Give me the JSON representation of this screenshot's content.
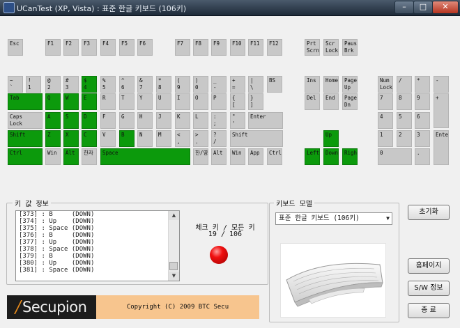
{
  "window": {
    "title": "UCanTest (XP, Vista) : 표준 한글 키보드 (106키)",
    "minimize": "–",
    "maximize": "□",
    "close": "✕"
  },
  "keyboard": {
    "function_row": [
      {
        "label": "Esc",
        "pressed": false
      },
      {
        "label": "F1",
        "pressed": false
      },
      {
        "label": "F2",
        "pressed": false
      },
      {
        "label": "F3",
        "pressed": false
      },
      {
        "label": "F4",
        "pressed": false
      },
      {
        "label": "F5",
        "pressed": false
      },
      {
        "label": "F6",
        "pressed": false
      },
      {
        "label": "F7",
        "pressed": false
      },
      {
        "label": "F8",
        "pressed": false
      },
      {
        "label": "F9",
        "pressed": false
      },
      {
        "label": "F10",
        "pressed": false
      },
      {
        "label": "F11",
        "pressed": false
      },
      {
        "label": "F12",
        "pressed": false
      },
      {
        "label": "Prt\nScrn",
        "pressed": false
      },
      {
        "label": "Scr\nLock",
        "pressed": false
      },
      {
        "label": "Paus\nBrk",
        "pressed": false
      }
    ],
    "number_row": [
      {
        "label": "~\n`",
        "pressed": false
      },
      {
        "label": "!\n1",
        "pressed": false
      },
      {
        "label": "@\n2",
        "pressed": false
      },
      {
        "label": "#\n3",
        "pressed": false
      },
      {
        "label": "$\n4",
        "pressed": true
      },
      {
        "label": "%\n5",
        "pressed": false
      },
      {
        "label": "^\n6",
        "pressed": false
      },
      {
        "label": "&\n7",
        "pressed": false
      },
      {
        "label": "*\n8",
        "pressed": false
      },
      {
        "label": "(\n9",
        "pressed": false
      },
      {
        "label": ")\n0",
        "pressed": false
      },
      {
        "label": "_\n-",
        "pressed": false
      },
      {
        "label": "+\n=",
        "pressed": false
      },
      {
        "label": "|\n\\",
        "pressed": false
      },
      {
        "label": "BS",
        "pressed": false
      }
    ],
    "tab_row": [
      {
        "label": "Tab",
        "pressed": true
      },
      {
        "label": "Q",
        "pressed": true
      },
      {
        "label": "W",
        "pressed": true
      },
      {
        "label": "E",
        "pressed": true
      },
      {
        "label": "R",
        "pressed": false
      },
      {
        "label": "T",
        "pressed": false
      },
      {
        "label": "Y",
        "pressed": false
      },
      {
        "label": "U",
        "pressed": false
      },
      {
        "label": "I",
        "pressed": false
      },
      {
        "label": "O",
        "pressed": false
      },
      {
        "label": "P",
        "pressed": false
      },
      {
        "label": "{\n[",
        "pressed": false
      },
      {
        "label": "}\n]",
        "pressed": false
      }
    ],
    "caps_row": [
      {
        "label": "Caps\nLock",
        "pressed": false
      },
      {
        "label": "A",
        "pressed": true
      },
      {
        "label": "S",
        "pressed": true
      },
      {
        "label": "D",
        "pressed": true
      },
      {
        "label": "F",
        "pressed": false
      },
      {
        "label": "G",
        "pressed": false
      },
      {
        "label": "H",
        "pressed": false
      },
      {
        "label": "J",
        "pressed": false
      },
      {
        "label": "K",
        "pressed": false
      },
      {
        "label": "L",
        "pressed": false
      },
      {
        "label": ":\n;",
        "pressed": false
      },
      {
        "label": "\"\n'",
        "pressed": false
      },
      {
        "label": "Enter",
        "pressed": false
      }
    ],
    "shift_row": [
      {
        "label": "Shift",
        "pressed": true
      },
      {
        "label": "Z",
        "pressed": true
      },
      {
        "label": "X",
        "pressed": true
      },
      {
        "label": "C",
        "pressed": true
      },
      {
        "label": "V",
        "pressed": false
      },
      {
        "label": "B",
        "pressed": true
      },
      {
        "label": "N",
        "pressed": false
      },
      {
        "label": "M",
        "pressed": false
      },
      {
        "label": "<\n,",
        "pressed": false
      },
      {
        "label": ">\n.",
        "pressed": false
      },
      {
        "label": "?\n/",
        "pressed": false
      },
      {
        "label": "Shift",
        "pressed": false
      }
    ],
    "bottom_row": [
      {
        "label": "Ctrl",
        "pressed": true
      },
      {
        "label": "Win",
        "pressed": false
      },
      {
        "label": "Alt",
        "pressed": true
      },
      {
        "label": "한자",
        "pressed": false
      },
      {
        "label": "Space",
        "pressed": true
      },
      {
        "label": "한/영",
        "pressed": false
      },
      {
        "label": "Alt",
        "pressed": false
      },
      {
        "label": "Win",
        "pressed": false
      },
      {
        "label": "App",
        "pressed": false
      },
      {
        "label": "Ctrl",
        "pressed": false
      }
    ],
    "nav_block": [
      {
        "label": "Ins",
        "pressed": false
      },
      {
        "label": "Home",
        "pressed": false
      },
      {
        "label": "Page\nUp",
        "pressed": false
      },
      {
        "label": "Del",
        "pressed": false
      },
      {
        "label": "End",
        "pressed": false
      },
      {
        "label": "Page\nDn",
        "pressed": false
      }
    ],
    "arrow_block": [
      {
        "label": "Up",
        "pressed": true
      },
      {
        "label": "Left",
        "pressed": true
      },
      {
        "label": "Down",
        "pressed": true
      },
      {
        "label": "Right",
        "pressed": true
      }
    ],
    "numpad": [
      {
        "label": "Num\nLock",
        "pressed": false
      },
      {
        "label": "/",
        "pressed": false
      },
      {
        "label": "*",
        "pressed": false
      },
      {
        "label": "-",
        "pressed": false
      },
      {
        "label": "7",
        "pressed": false
      },
      {
        "label": "8",
        "pressed": false
      },
      {
        "label": "9",
        "pressed": false
      },
      {
        "label": "+",
        "pressed": false
      },
      {
        "label": "4",
        "pressed": false
      },
      {
        "label": "5",
        "pressed": false
      },
      {
        "label": "6",
        "pressed": false
      },
      {
        "label": "1",
        "pressed": false
      },
      {
        "label": "2",
        "pressed": false
      },
      {
        "label": "3",
        "pressed": false
      },
      {
        "label": "Enter",
        "pressed": false
      },
      {
        "label": "0",
        "pressed": false
      },
      {
        "label": ".",
        "pressed": false
      }
    ]
  },
  "key_info": {
    "title": "키 값 정보",
    "log_lines": [
      "[373] : B     (DOWN)",
      "[374] : Up    (DOWN)",
      "[375] : Space (DOWN)",
      "[376] : B     (DOWN)",
      "[377] : Up    (DOWN)",
      "[378] : Space (DOWN)",
      "[379] : B     (DOWN)",
      "[380] : Up    (DOWN)",
      "[381] : Space (DOWN)"
    ],
    "check_label": "체크 키 / 모든 키",
    "check_count": "19 / 106"
  },
  "keyboard_model": {
    "title": "키보드 모델",
    "selected": "표준 한글 키보드 (106키)"
  },
  "buttons": {
    "reset": "초기화",
    "homepage": "홈페이지",
    "sw_info": "S/W 정보",
    "exit": "종  료"
  },
  "footer": {
    "logo_text": "Secupion",
    "copyright": "Copyright (C) 2009 BTC Secu"
  },
  "colors": {
    "pressed_key": "#0c9a0c",
    "idle_key": "#c8c8c8",
    "copyright_bar": "#f7c58e"
  }
}
